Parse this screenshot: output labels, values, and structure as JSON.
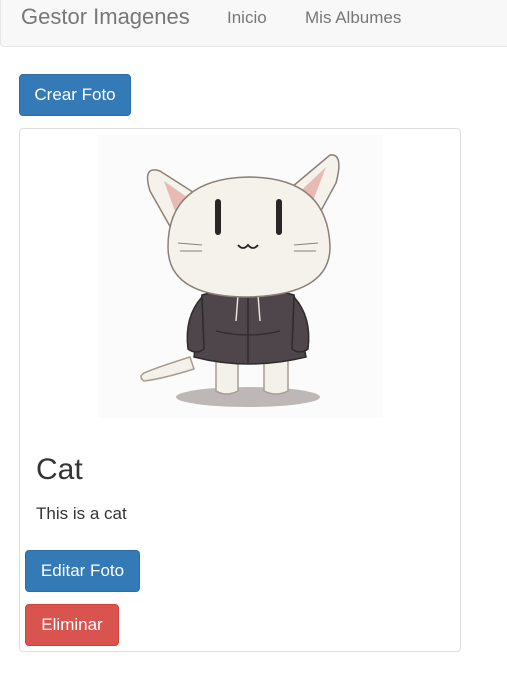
{
  "navbar": {
    "brand": "Gestor Imagenes",
    "links": [
      "Inicio",
      "Mis Albumes"
    ]
  },
  "actions": {
    "create_label": "Crear Foto"
  },
  "photo_card": {
    "image_icon": "cat-illustration",
    "title": "Cat",
    "description": "This is a cat",
    "edit_label": "Editar Foto",
    "delete_label": "Eliminar"
  },
  "colors": {
    "primary": "#337ab7",
    "danger": "#d9534f",
    "navbar_bg": "#f8f8f8",
    "nav_text": "#777777"
  }
}
